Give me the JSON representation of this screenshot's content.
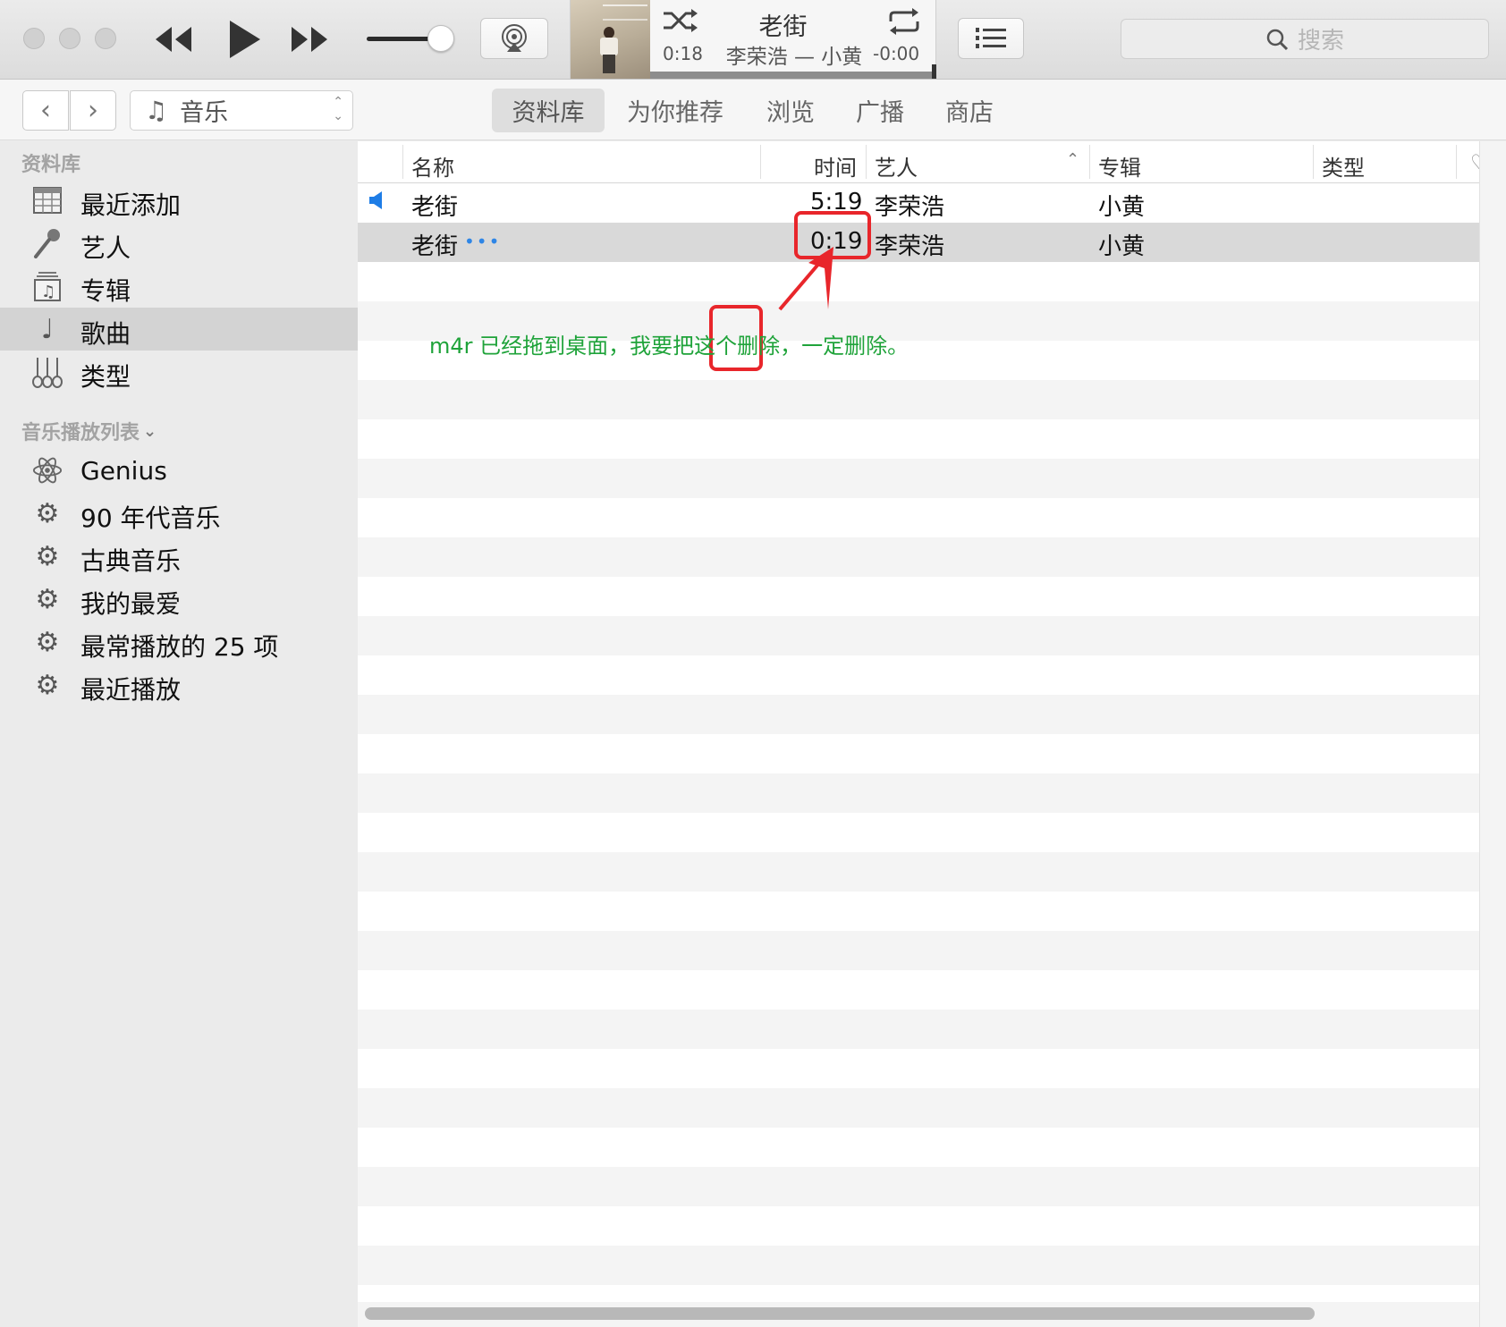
{
  "player": {
    "now_playing_title": "老街",
    "now_playing_subtitle": "李荣浩 — 小黄",
    "elapsed": "0:18",
    "remaining": "-0:00",
    "volume_level": 0.75,
    "search_placeholder": "搜索"
  },
  "navbar": {
    "media_selector": "音乐",
    "tabs": [
      {
        "label": "资料库",
        "active": true
      },
      {
        "label": "为你推荐",
        "active": false
      },
      {
        "label": "浏览",
        "active": false
      },
      {
        "label": "广播",
        "active": false
      },
      {
        "label": "商店",
        "active": false
      }
    ]
  },
  "sidebar": {
    "library_heading": "资料库",
    "library_items": [
      {
        "label": "最近添加",
        "icon": "grid-icon"
      },
      {
        "label": "艺人",
        "icon": "microphone-icon"
      },
      {
        "label": "专辑",
        "icon": "album-icon"
      },
      {
        "label": "歌曲",
        "icon": "music-note-icon",
        "selected": true
      },
      {
        "label": "类型",
        "icon": "guitars-icon"
      }
    ],
    "playlists_heading": "音乐播放列表",
    "playlist_items": [
      {
        "label": "Genius",
        "icon": "atom-icon"
      },
      {
        "label": "90 年代音乐",
        "icon": "gear-icon"
      },
      {
        "label": "古典音乐",
        "icon": "gear-icon"
      },
      {
        "label": "我的最爱",
        "icon": "gear-icon"
      },
      {
        "label": "最常播放的 25 项",
        "icon": "gear-icon"
      },
      {
        "label": "最近播放",
        "icon": "gear-icon"
      }
    ]
  },
  "songs": {
    "columns": {
      "name": "名称",
      "time": "时间",
      "artist": "艺人",
      "album": "专辑",
      "genre": "类型"
    },
    "rows": [
      {
        "name": "老街",
        "time": "5:19",
        "artist": "李荣浩",
        "album": "小黄",
        "playing": true,
        "selected": false
      },
      {
        "name": "老街",
        "time": "0:19",
        "artist": "李荣浩",
        "album": "小黄",
        "playing": false,
        "selected": true,
        "ellipsis": "•••"
      }
    ]
  },
  "annotation": {
    "note": "m4r 已经拖到桌面，我要把这个删除，一定删除。",
    "color": "#e8262b",
    "note_color": "#1fa33a"
  }
}
